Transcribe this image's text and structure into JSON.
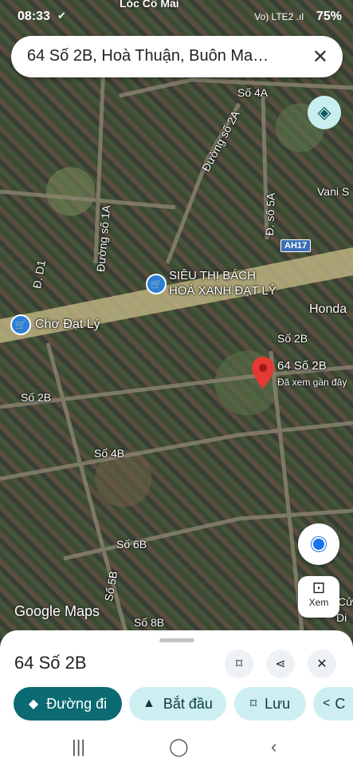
{
  "status": {
    "time": "08:33",
    "check": "✔",
    "signal": "Vo) LTE2 .ıl",
    "battery": "75%"
  },
  "top_caption": "Lóc Cô Mai",
  "search": {
    "text": "64 Số 2B, Hoà Thuận, Buôn Ma…",
    "close": "✕"
  },
  "map": {
    "roads": [
      "Số 4A",
      "Đường số 2A",
      "Vani S",
      "Đ. số 5A",
      "Đường số 1A",
      "Đ. D1",
      "Số 2B",
      "Số 2B",
      "Số 4B",
      "Số 6B",
      "Số 5B",
      "Số 8B",
      "Cử",
      "Di"
    ],
    "highway": "AH17",
    "pois": {
      "store": "SIÊU THỊ BÁCH\nHOÁ XANH ĐẠT LÝ",
      "market": "Chợ Đạt Lý",
      "honda": "Honda"
    },
    "pin": {
      "title": "64 Số 2B",
      "subtitle": "Đã xem gần đây"
    },
    "logo": "Google Maps"
  },
  "controls": {
    "xem": "Xem",
    "xem_icon": "⊡"
  },
  "sheet": {
    "title": "64 Số 2B",
    "actions": [
      "Đường đi",
      "Bắt đầu",
      "Lưu",
      "C"
    ],
    "action_icons": [
      "◆",
      "▲",
      "⌑",
      "<"
    ]
  },
  "navbar": [
    "|||",
    "◯",
    "‹"
  ],
  "colors": {
    "accent": "#0b6a72",
    "chip": "#cdeff1",
    "pin": "#e53935",
    "blue": "#1a73e8"
  }
}
